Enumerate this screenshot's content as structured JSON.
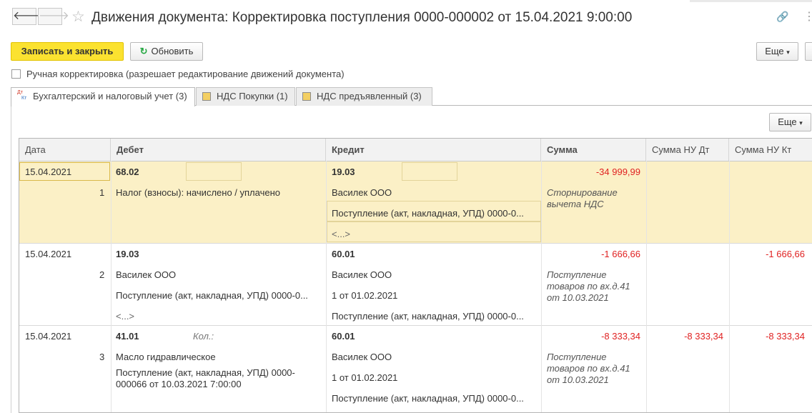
{
  "window": {
    "title": "Движения документа: Корректировка поступления 0000-000002 от 15.04.2021 9:00:00",
    "back_glyph": "🡐",
    "forward_glyph": "🡒",
    "star_glyph": "☆",
    "link_glyph": "🔗",
    "more_glyph": "⋮"
  },
  "toolbar": {
    "save_close_label": "Записать и закрыть",
    "refresh_label": "Обновить",
    "refresh_glyph": "↻",
    "more_label": "Еще",
    "dropdown_glyph": "▾"
  },
  "manual_correction": {
    "label": "Ручная корректировка (разрешает редактирование движений документа)",
    "checked": false
  },
  "tabs": [
    {
      "label": "Бухгалтерский и налоговый учет (3)",
      "icon": "dt-kt-icon"
    },
    {
      "label": "НДС Покупки (1)",
      "icon": "register-icon"
    },
    {
      "label": "НДС предъявленный (3)",
      "icon": "register-icon"
    }
  ],
  "dtkt": {
    "dt": "Дт",
    "kt": "Кт"
  },
  "table": {
    "more_label": "Еще",
    "columns": [
      "Дата",
      "Дебет",
      "Кредит",
      "Сумма",
      "Сумма НУ Дт",
      "Сумма НУ Кт"
    ],
    "rows": [
      {
        "date": "15.04.2021",
        "num": "1",
        "debit_account": "68.02",
        "debit_lines": [
          "Налог (взносы): начислено / уплачено"
        ],
        "credit_account": "19.03",
        "credit_lines": [
          "Василек ООО",
          "Поступление (акт, накладная, УПД) 0000-0...",
          "<...>"
        ],
        "sum": "-34 999,99",
        "content": "Сторнирование вычета НДС",
        "nu_dt": "",
        "nu_kt": ""
      },
      {
        "date": "15.04.2021",
        "num": "2",
        "debit_account": "19.03",
        "debit_lines": [
          "Василек ООО",
          "Поступление (акт, накладная, УПД) 0000-0...",
          "<...>"
        ],
        "credit_account": "60.01",
        "credit_lines": [
          "Василек ООО",
          "1 от 01.02.2021",
          "Поступление (акт, накладная, УПД) 0000-0..."
        ],
        "sum": "-1 666,66",
        "content": "Поступление товаров по вх.д.41 от 10.03.2021",
        "nu_dt": "",
        "nu_kt": "-1 666,66"
      },
      {
        "date": "15.04.2021",
        "num": "3",
        "debit_account": "41.01",
        "debit_qty_label": "Кол.:",
        "debit_lines": [
          "Масло гидравлическое",
          "Поступление (акт, накладная, УПД) 0000-000066 от 10.03.2021 7:00:00"
        ],
        "credit_account": "60.01",
        "credit_lines": [
          "Василек ООО",
          "1 от 01.02.2021",
          "Поступление (акт, накладная, УПД) 0000-0..."
        ],
        "sum": "-8 333,34",
        "content": "Поступление товаров по вх.д.41 от 10.03.2021",
        "nu_dt": "-8 333,34",
        "nu_kt": "-8 333,34"
      }
    ]
  },
  "colors": {
    "primary_button": "#fbe230",
    "selected_row": "#fbf0c6",
    "negative": "#e02222"
  }
}
